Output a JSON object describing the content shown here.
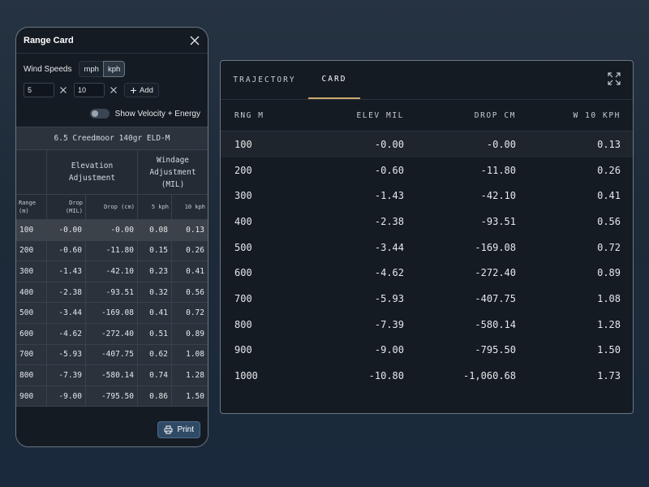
{
  "range_card": {
    "title": "Range Card",
    "wind_speeds_label": "Wind Speeds",
    "units": [
      "mph",
      "kph"
    ],
    "active_unit": "kph",
    "speed_inputs": [
      "5",
      "10"
    ],
    "add_label": "Add",
    "toggle_label": "Show Velocity + Energy",
    "table_caption": "6.5 Creedmoor 140gr ELD-M",
    "group_elevation": "Elevation Adjustment",
    "group_windage": "Windage Adjustment (MIL)",
    "col_range": "Range (m)",
    "col_drop_mil": "Drop (MIL)",
    "col_drop_cm": "Drop (cm)",
    "col_w5": "5 kph",
    "col_w10": "10 kph",
    "rows": [
      {
        "range": "100",
        "drop_mil": "-0.00",
        "drop_cm": "-0.00",
        "w5": "0.08",
        "w10": "0.13"
      },
      {
        "range": "200",
        "drop_mil": "-0.60",
        "drop_cm": "-11.80",
        "w5": "0.15",
        "w10": "0.26"
      },
      {
        "range": "300",
        "drop_mil": "-1.43",
        "drop_cm": "-42.10",
        "w5": "0.23",
        "w10": "0.41"
      },
      {
        "range": "400",
        "drop_mil": "-2.38",
        "drop_cm": "-93.51",
        "w5": "0.32",
        "w10": "0.56"
      },
      {
        "range": "500",
        "drop_mil": "-3.44",
        "drop_cm": "-169.08",
        "w5": "0.41",
        "w10": "0.72"
      },
      {
        "range": "600",
        "drop_mil": "-4.62",
        "drop_cm": "-272.40",
        "w5": "0.51",
        "w10": "0.89"
      },
      {
        "range": "700",
        "drop_mil": "-5.93",
        "drop_cm": "-407.75",
        "w5": "0.62",
        "w10": "1.08"
      },
      {
        "range": "800",
        "drop_mil": "-7.39",
        "drop_cm": "-580.14",
        "w5": "0.74",
        "w10": "1.28"
      },
      {
        "range": "900",
        "drop_mil": "-9.00",
        "drop_cm": "-795.50",
        "w5": "0.86",
        "w10": "1.50"
      }
    ],
    "print_label": "Print"
  },
  "trajectory_card": {
    "tabs": [
      "TRAJECTORY",
      "CARD"
    ],
    "active_tab": "CARD",
    "headers": [
      "RNG M",
      "ELEV MIL",
      "DROP CM",
      "W 10 KPH"
    ],
    "rows": [
      {
        "rng": "100",
        "elev": "-0.00",
        "drop": "-0.00",
        "w": "0.13"
      },
      {
        "rng": "200",
        "elev": "-0.60",
        "drop": "-11.80",
        "w": "0.26"
      },
      {
        "rng": "300",
        "elev": "-1.43",
        "drop": "-42.10",
        "w": "0.41"
      },
      {
        "rng": "400",
        "elev": "-2.38",
        "drop": "-93.51",
        "w": "0.56"
      },
      {
        "rng": "500",
        "elev": "-3.44",
        "drop": "-169.08",
        "w": "0.72"
      },
      {
        "rng": "600",
        "elev": "-4.62",
        "drop": "-272.40",
        "w": "0.89"
      },
      {
        "rng": "700",
        "elev": "-5.93",
        "drop": "-407.75",
        "w": "1.08"
      },
      {
        "rng": "800",
        "elev": "-7.39",
        "drop": "-580.14",
        "w": "1.28"
      },
      {
        "rng": "900",
        "elev": "-9.00",
        "drop": "-795.50",
        "w": "1.50"
      },
      {
        "rng": "1000",
        "elev": "-10.80",
        "drop": "-1,060.68",
        "w": "1.73"
      }
    ]
  },
  "colors": {
    "accent_tab_underline": "#c9a86a",
    "print_button": "#2f4a65",
    "panel_bg": "#141b23"
  },
  "icons": {
    "close": "close-icon",
    "clear": "x-icon",
    "add": "plus-icon",
    "print": "printer-icon",
    "expand": "expand-icon"
  }
}
